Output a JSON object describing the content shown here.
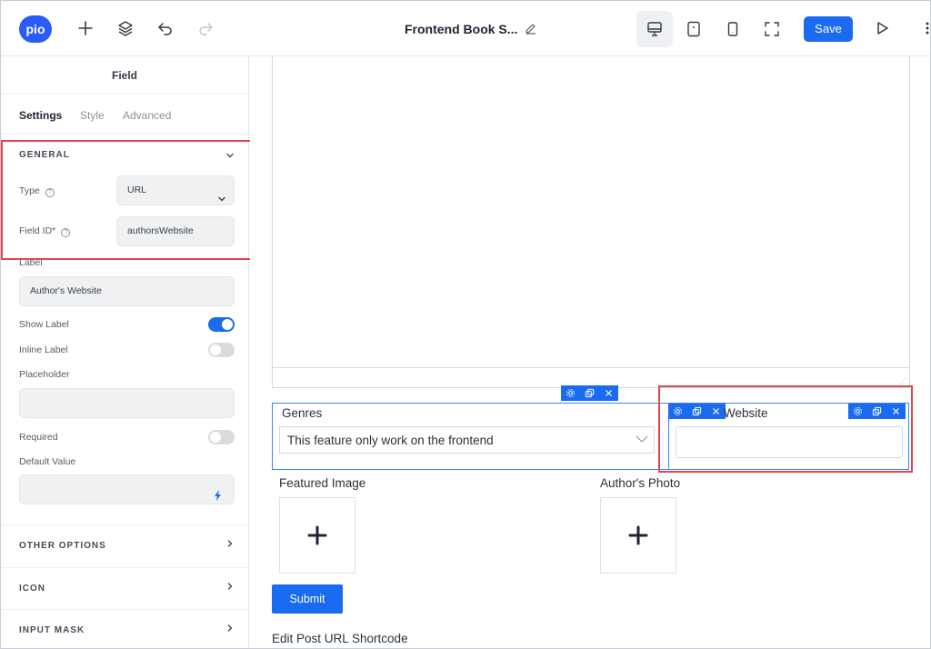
{
  "app": {
    "logo_text": "pio",
    "brand_color": "#2a5bf6",
    "accent": "#1a6bf0"
  },
  "topbar": {
    "doc_title": "Frontend Book S...",
    "save_label": "Save",
    "icons": [
      "plus-icon",
      "layers-icon",
      "undo-icon",
      "redo-icon",
      "edit-icon",
      "desktop-icon",
      "tablet-icon",
      "mobile-icon",
      "fullscreen-icon",
      "preview-play-icon",
      "more-vertical-icon"
    ],
    "active_device": "desktop"
  },
  "sidebar": {
    "header": "Field",
    "tabs": [
      {
        "label": "Settings",
        "active": true
      },
      {
        "label": "Style",
        "active": false
      },
      {
        "label": "Advanced",
        "active": false
      }
    ],
    "general": {
      "title": "GENERAL",
      "type_label": "Type",
      "type_value": "URL",
      "field_id_label": "Field ID*",
      "field_id_value": "authorsWebsite",
      "label_label": "Label",
      "label_value": "Author's Website",
      "show_label": "Show Label",
      "show_label_on": true,
      "inline_label": "Inline Label",
      "inline_label_on": false,
      "placeholder_label": "Placeholder",
      "placeholder_value": "",
      "required_label": "Required",
      "required_on": false,
      "default_value_label": "Default Value",
      "default_value": ""
    },
    "sections": [
      "OTHER OPTIONS",
      "ICON",
      "INPUT MASK"
    ]
  },
  "canvas": {
    "genres_label": "Genres",
    "genres_select_value": "This feature only work on the frontend",
    "website_label_partial": "Website",
    "featured_image_label": "Featured Image",
    "authors_photo_label": "Author's Photo",
    "submit_label": "Submit",
    "shortcode_label": "Edit Post URL Shortcode"
  }
}
